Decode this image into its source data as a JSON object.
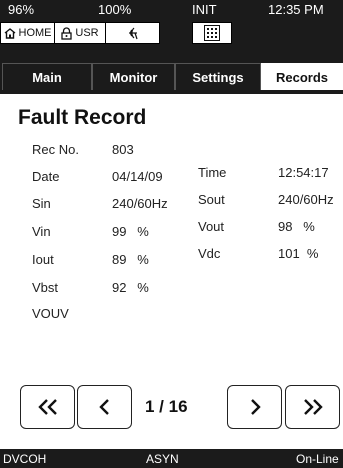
{
  "statusbar": {
    "battery": "96%",
    "load": "100%",
    "mode": "INIT",
    "time": "12:35 PM"
  },
  "toolbar": {
    "home_label": "HOME",
    "user_label": "USR"
  },
  "tabs": [
    {
      "label": "Main",
      "active": false
    },
    {
      "label": "Monitor",
      "active": false
    },
    {
      "label": "Settings",
      "active": false
    },
    {
      "label": "Records",
      "active": true
    }
  ],
  "record": {
    "title": "Fault Record",
    "left": [
      {
        "label": "Rec No.",
        "value": "803"
      },
      {
        "label": "Date",
        "value": "04/14/09"
      },
      {
        "label": "Sin",
        "value": "240/60Hz"
      },
      {
        "label": "Vin",
        "value": "99   %"
      },
      {
        "label": "Iout",
        "value": "89   %"
      },
      {
        "label": "Vbst",
        "value": "92   %"
      },
      {
        "label": "VOUV",
        "value": ""
      }
    ],
    "right": [
      {
        "label": "Time",
        "value": "12:54:17"
      },
      {
        "label": "Sout",
        "value": "240/60Hz"
      },
      {
        "label": "Vout",
        "value": "98   %"
      },
      {
        "label": "Vdc",
        "value": "101  %"
      }
    ]
  },
  "pager": {
    "indicator": "1 / 16"
  },
  "bottombar": {
    "left": "DVCOH",
    "center": "ASYN",
    "right": "On-Line"
  }
}
